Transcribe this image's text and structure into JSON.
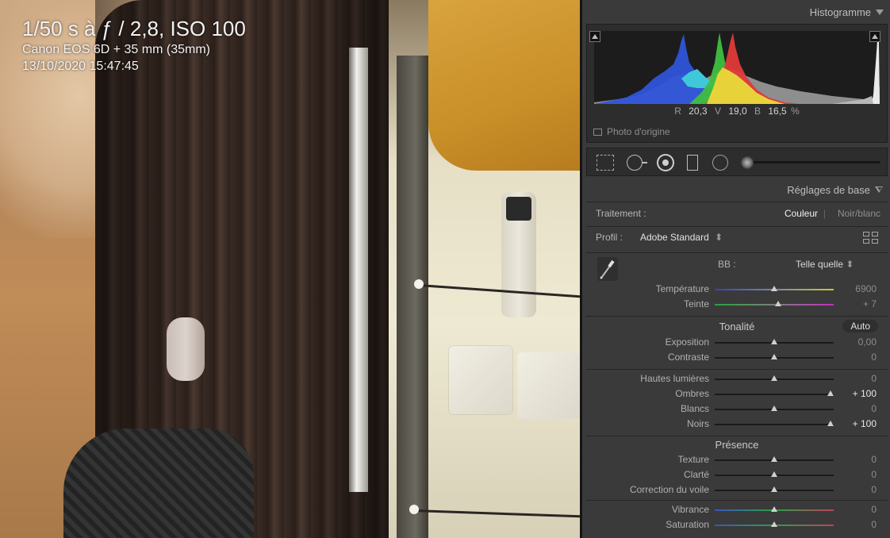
{
  "photo": {
    "exif_line1": "1/50 s à ƒ / 2,8, ISO 100",
    "exif_line2": "Canon EOS 6D + 35 mm (35mm)",
    "exif_line3": "13/10/2020 15:47:45"
  },
  "histogram": {
    "title": "Histogramme",
    "r_label": "R",
    "r_value": "20,3",
    "g_label": "V",
    "g_value": "19,0",
    "b_label": "B",
    "b_value": "16,5",
    "unit": "%",
    "original_photo_label": "Photo d'origine"
  },
  "tool_strip": {
    "icons": [
      "crop-icon",
      "spot-removal-icon",
      "red-eye-icon",
      "graduated-filter-icon",
      "radial-filter-icon",
      "brush-icon"
    ]
  },
  "basic": {
    "title": "Réglages de base",
    "treatment_label": "Traitement :",
    "treatment_color": "Couleur",
    "treatment_separator": "|",
    "treatment_bw": "Noir/blanc",
    "profile_label": "Profil :",
    "profile_value": "Adobe Standard",
    "wb_label": "BB :",
    "wb_value": "Telle quelle",
    "tone_title": "Tonalité",
    "auto_label": "Auto",
    "presence_title": "Présence",
    "sliders": {
      "temperature": {
        "label": "Température",
        "value": "6900",
        "pos": 0.5
      },
      "tint": {
        "label": "Teinte",
        "value": "+ 7",
        "pos": 0.53
      },
      "exposure": {
        "label": "Exposition",
        "value": "0,00",
        "pos": 0.5
      },
      "contrast": {
        "label": "Contraste",
        "value": "0",
        "pos": 0.5
      },
      "highlights": {
        "label": "Hautes lumières",
        "value": "0",
        "pos": 0.5
      },
      "shadows": {
        "label": "Ombres",
        "value": "+ 100",
        "pos": 0.97
      },
      "whites": {
        "label": "Blancs",
        "value": "0",
        "pos": 0.5
      },
      "blacks": {
        "label": "Noirs",
        "value": "+ 100",
        "pos": 0.97
      },
      "texture": {
        "label": "Texture",
        "value": "0",
        "pos": 0.5
      },
      "clarity": {
        "label": "Clarté",
        "value": "0",
        "pos": 0.5
      },
      "dehaze": {
        "label": "Correction du voile",
        "value": "0",
        "pos": 0.5
      },
      "vibrance": {
        "label": "Vibrance",
        "value": "0",
        "pos": 0.5
      },
      "saturation": {
        "label": "Saturation",
        "value": "0",
        "pos": 0.5
      }
    }
  },
  "colors": {
    "panel_bg": "#3a3a3a",
    "histogram_red": "#e03a3a",
    "histogram_green": "#3fbf3f",
    "histogram_blue": "#2f55d9",
    "histogram_yellow": "#e8d23a",
    "histogram_cyan": "#3fc9d8"
  }
}
